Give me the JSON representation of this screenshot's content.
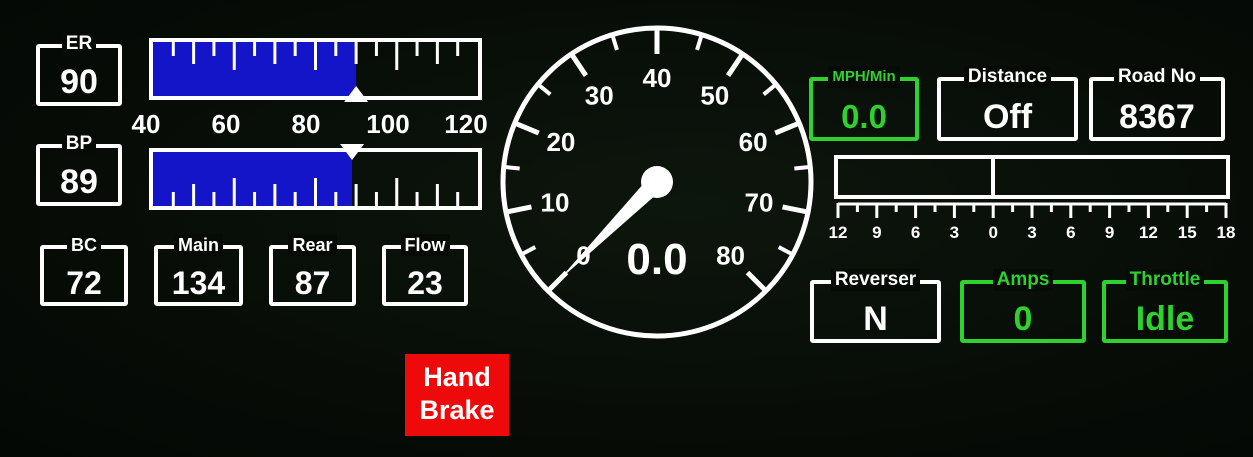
{
  "readouts": {
    "er": {
      "label": "ER",
      "value": "90"
    },
    "bp": {
      "label": "BP",
      "value": "89"
    },
    "bc": {
      "label": "BC",
      "value": "72"
    },
    "main": {
      "label": "Main",
      "value": "134"
    },
    "rear": {
      "label": "Rear",
      "value": "87"
    },
    "flow": {
      "label": "Flow",
      "value": "23"
    },
    "mph_min": {
      "label": "MPH/Min",
      "value": "0.0"
    },
    "distance": {
      "label": "Distance",
      "value": "Off"
    },
    "road_no": {
      "label": "Road No",
      "value": "8367"
    },
    "reverser": {
      "label": "Reverser",
      "value": "N"
    },
    "amps": {
      "label": "Amps",
      "value": "0"
    },
    "throttle": {
      "label": "Throttle",
      "value": "Idle"
    }
  },
  "pressure_gauge": {
    "min": 40,
    "max": 120,
    "labels": [
      "40",
      "60",
      "80",
      "100",
      "120"
    ],
    "er_value": 90,
    "bp_value": 89,
    "fill_color": "#1414c8"
  },
  "speedometer": {
    "min": 0,
    "max": 80,
    "labels": [
      "0",
      "10",
      "20",
      "30",
      "40",
      "50",
      "60",
      "70",
      "80"
    ],
    "needle_value": 0,
    "digital_value": "0.0"
  },
  "load_meter": {
    "labels": [
      "12",
      "9",
      "6",
      "3",
      "0",
      "3",
      "6",
      "9",
      "12",
      "15",
      "18"
    ]
  },
  "hand_brake": {
    "line1": "Hand",
    "line2": "Brake",
    "color": "#ee0a0a"
  },
  "colors": {
    "text": "#ffffff",
    "active_green": "#2fd12f",
    "background": "#060b06"
  }
}
